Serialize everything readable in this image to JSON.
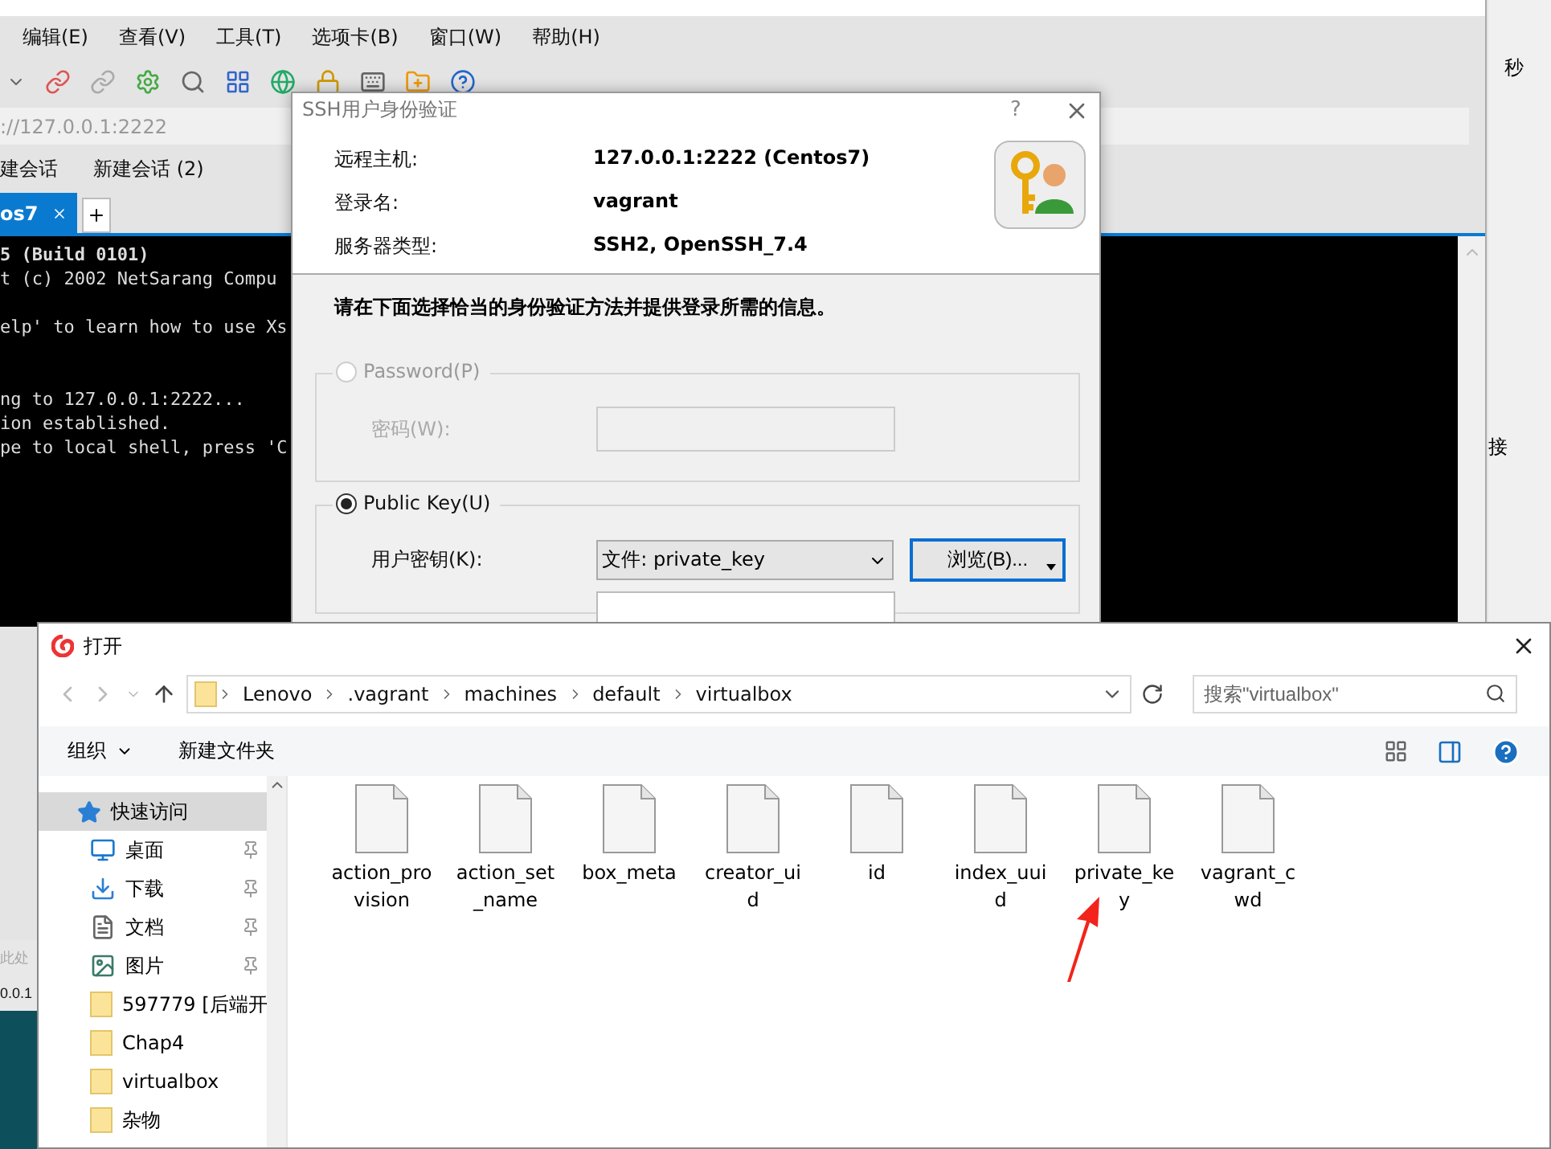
{
  "xshell": {
    "menu": [
      "编辑(E)",
      "查看(V)",
      "工具(T)",
      "选项卡(B)",
      "窗口(W)",
      "帮助(H)"
    ],
    "address": "://127.0.0.1:2222",
    "session_links": [
      "建会话",
      "新建会话 (2)"
    ],
    "tabs": [
      {
        "label": "os7",
        "selected": true
      }
    ],
    "terminal_header": "5 (Build 0101)",
    "terminal_blocks": [
      [
        "t (c) 2002 NetSarang Compu"
      ],
      [
        "elp' to learn how to use Xs"
      ],
      [
        "ng to 127.0.0.1:2222...",
        "ion established.",
        "pe to local shell, press 'C"
      ]
    ]
  },
  "side_app": {
    "texts": [
      "秒",
      "接"
    ]
  },
  "left_fragments": [
    "此处",
    "0.0.1"
  ],
  "auth_dialog": {
    "title": "SSH用户身份验证",
    "help": "?",
    "info": [
      {
        "label": "远程主机:",
        "value": "127.0.0.1:2222 (Centos7)"
      },
      {
        "label": "登录名:",
        "value": "vagrant"
      },
      {
        "label": "服务器类型:",
        "value": "SSH2, OpenSSH_7.4"
      }
    ],
    "instruction": "请在下面选择恰当的身份验证方法并提供登录所需的信息。",
    "methods": [
      {
        "label": "Password(P)",
        "selected": false,
        "disabled": true,
        "field_label": "密码(W):",
        "kind": "input"
      },
      {
        "label": "Public Key(U)",
        "selected": true,
        "disabled": false,
        "field_label": "用户密钥(K):",
        "kind": "select",
        "value": "文件: private_key",
        "button": "浏览(B)..."
      }
    ]
  },
  "open_dialog": {
    "title": "打开",
    "path": [
      "Lenovo",
      ".vagrant",
      "machines",
      "default",
      "virtualbox"
    ],
    "search": {
      "placeholder": "搜索\"virtualbox\""
    },
    "toolbar": [
      "组织",
      "新建文件夹"
    ],
    "sidebar": [
      {
        "label": "快速访问",
        "kind": "quick_access",
        "selected": true
      },
      {
        "label": "桌面",
        "kind": "desktop",
        "selected": false
      },
      {
        "label": "下载",
        "kind": "downloads",
        "selected": false
      },
      {
        "label": "文档",
        "kind": "documents",
        "selected": false
      },
      {
        "label": "图片",
        "kind": "pictures",
        "selected": false
      },
      {
        "label": "597779 [后端开",
        "kind": "folder",
        "selected": false
      },
      {
        "label": "Chap4",
        "kind": "folder",
        "selected": false
      },
      {
        "label": "virtualbox",
        "kind": "folder",
        "selected": false
      },
      {
        "label": "杂物",
        "kind": "folder",
        "selected": false
      }
    ],
    "files": [
      {
        "name": "action_provision"
      },
      {
        "name": "action_set_name"
      },
      {
        "name": "box_meta"
      },
      {
        "name": "creator_uid"
      },
      {
        "name": "id"
      },
      {
        "name": "index_uuid"
      },
      {
        "name": "private_key"
      },
      {
        "name": "vagrant_cwd"
      }
    ]
  }
}
